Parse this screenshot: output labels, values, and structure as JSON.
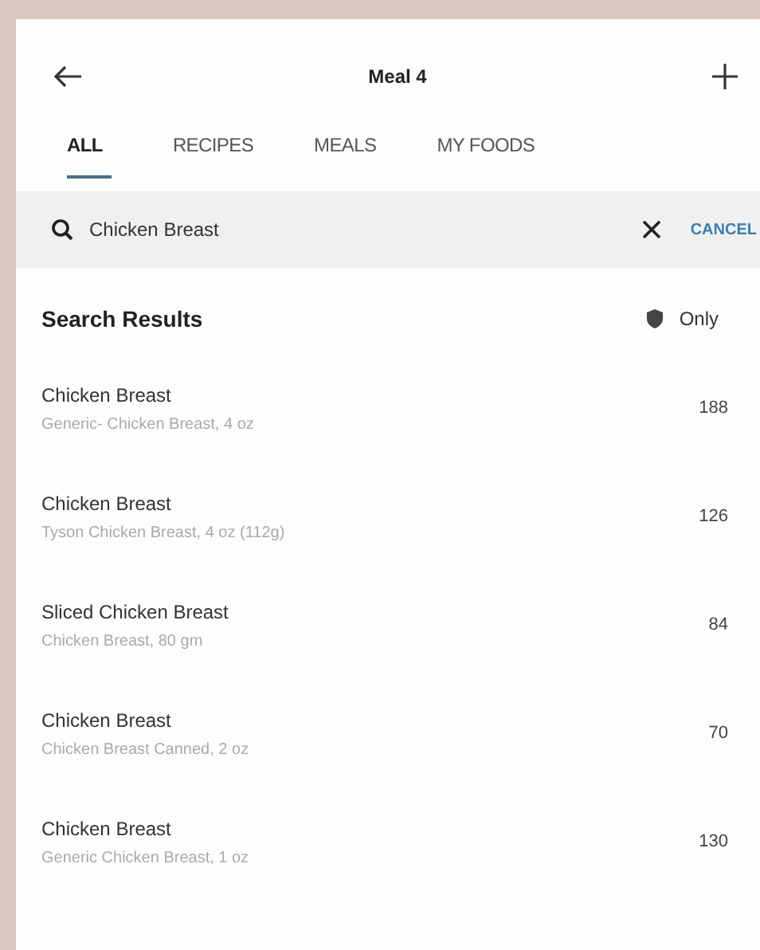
{
  "header": {
    "title": "Meal 4"
  },
  "tabs": [
    {
      "label": "ALL",
      "selected": true
    },
    {
      "label": "RECIPES",
      "selected": false
    },
    {
      "label": "MEALS",
      "selected": false
    },
    {
      "label": "MY FOODS",
      "selected": false
    }
  ],
  "search": {
    "value": "Chicken Breast",
    "cancel": "CANCEL"
  },
  "results": {
    "title": "Search Results",
    "filter": "Only"
  },
  "items": [
    {
      "name": "Chicken Breast",
      "detail": "Generic- Chicken Breast, 4 oz",
      "calories": "188"
    },
    {
      "name": "Chicken Breast",
      "detail": "Tyson Chicken Breast, 4 oz (112g)",
      "calories": "126"
    },
    {
      "name": "Sliced Chicken Breast",
      "detail": "Chicken Breast, 80 gm",
      "calories": "84"
    },
    {
      "name": "Chicken Breast",
      "detail": "Chicken Breast Canned, 2 oz",
      "calories": "70"
    },
    {
      "name": "Chicken Breast",
      "detail": "Generic Chicken Breast, 1 oz",
      "calories": "130"
    }
  ]
}
